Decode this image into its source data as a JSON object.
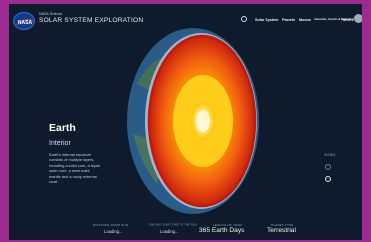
{
  "header": {
    "brand_small": "NASA Science",
    "brand_title": "SOLAR SYSTEM EXPLORATION",
    "nav": [
      "Solar System",
      "Planets",
      "Moons",
      "Asteroids, Comets & Meteors",
      "MORE"
    ]
  },
  "planet": {
    "name": "Earth",
    "section": "Interior",
    "description": "Earth's internal structure consists of multiple layers, including a solid core, a liquid outer core, a semi-solid mantle and a rocky external crust"
  },
  "view": {
    "label": "VIEWS"
  },
  "stats": [
    {
      "label": "DISTANCE FROM SUN",
      "value": "Loading..."
    },
    {
      "label": "ONE WAY LIGHT TIME TO THE SUN",
      "value": "Loading..."
    },
    {
      "label": "LENGTH OF YEAR",
      "value": "365 Earth Days"
    },
    {
      "label": "PLANET TYPE",
      "value": "Terrestrial"
    }
  ],
  "colors": {
    "background": "#0f1b2c",
    "page_border": "#9c2a8f",
    "core": "#ffd400",
    "mantle": "#e23a12",
    "crust": "#3f6ea3"
  }
}
